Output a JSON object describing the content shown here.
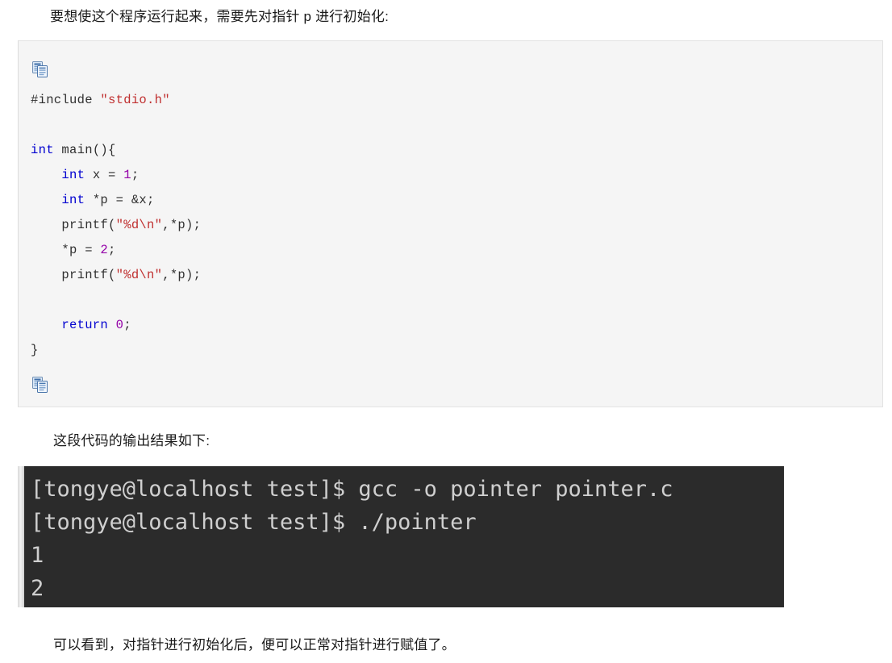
{
  "intro_paragraph": "要想使这个程序运行起来，需要先对指针 p 进行初始化:",
  "output_caption": "这段代码的输出结果如下:",
  "closing_paragraph": "可以看到，对指针进行初始化后，便可以正常对指针进行赋值了。",
  "code_block": {
    "language": "c",
    "copy_icon_top": "copy-icon",
    "copy_icon_bottom": "copy-icon",
    "background_color": "#f5f5f5",
    "keyword_color": "#0000d0",
    "string_color": "#c03030",
    "number_color": "#9400a8",
    "lines": [
      [
        {
          "t": "#include ",
          "c": "pl"
        },
        {
          "t": "\"stdio.h\"",
          "c": "s"
        }
      ],
      [],
      [
        {
          "t": "int",
          "c": "k"
        },
        {
          "t": " main(){",
          "c": "pl"
        }
      ],
      [
        {
          "t": "    ",
          "c": "pl"
        },
        {
          "t": "int",
          "c": "k"
        },
        {
          "t": " x = ",
          "c": "pl"
        },
        {
          "t": "1",
          "c": "n"
        },
        {
          "t": ";",
          "c": "pl"
        }
      ],
      [
        {
          "t": "    ",
          "c": "pl"
        },
        {
          "t": "int",
          "c": "k"
        },
        {
          "t": " *p = &x;",
          "c": "pl"
        }
      ],
      [
        {
          "t": "    printf(",
          "c": "pl"
        },
        {
          "t": "\"%d\\n\"",
          "c": "s"
        },
        {
          "t": ",*p);",
          "c": "pl"
        }
      ],
      [
        {
          "t": "    *p = ",
          "c": "pl"
        },
        {
          "t": "2",
          "c": "n"
        },
        {
          "t": ";",
          "c": "pl"
        }
      ],
      [
        {
          "t": "    printf(",
          "c": "pl"
        },
        {
          "t": "\"%d\\n\"",
          "c": "s"
        },
        {
          "t": ",*p);",
          "c": "pl"
        }
      ],
      [],
      [
        {
          "t": "    ",
          "c": "pl"
        },
        {
          "t": "return",
          "c": "k"
        },
        {
          "t": " ",
          "c": "pl"
        },
        {
          "t": "0",
          "c": "n"
        },
        {
          "t": ";",
          "c": "pl"
        }
      ],
      [
        {
          "t": "}",
          "c": "pl"
        }
      ]
    ]
  },
  "terminal": {
    "background_color": "#2b2b2b",
    "text_color": "#cfcfcf",
    "prompt": "[tongye@localhost test]$",
    "lines": [
      "[tongye@localhost test]$ gcc -o pointer pointer.c",
      "[tongye@localhost test]$ ./pointer",
      "1",
      "2"
    ]
  }
}
